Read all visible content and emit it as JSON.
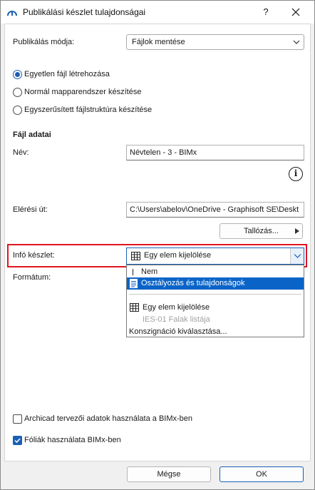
{
  "window": {
    "title": "Publikálási készlet tulajdonságai",
    "help_label": "?"
  },
  "publish_mode": {
    "label": "Publikálás módja:",
    "value": "Fájlok mentése"
  },
  "radio_options": [
    {
      "label": "Egyetlen fájl létrehozása",
      "selected": true
    },
    {
      "label": "Normál mapparendszer készítése",
      "selected": false
    },
    {
      "label": "Egyszerűsített fájlstruktúra készítése",
      "selected": false
    }
  ],
  "file_data": {
    "heading": "Fájl adatai",
    "name_label": "Név:",
    "name_value": "Névtelen - 3 - BIMx",
    "info_icon": "i",
    "path_label": "Elérési út:",
    "path_value": "C:\\Users\\abelov\\OneDrive - Graphisoft SE\\Deskt",
    "browse_label": "Tallózás..."
  },
  "info_set": {
    "label": "Infó készlet:",
    "selected": "Egy elem kijelölése",
    "options": [
      {
        "label": "Nem",
        "icon": "text-cursor-icon",
        "disabled": false,
        "highlighted": false
      },
      {
        "label": "Osztályozás és tulajdonságok",
        "icon": "document-icon",
        "disabled": false,
        "highlighted": true
      },
      {
        "label": "Egy elem kijelölése",
        "icon": "grid-icon",
        "disabled": false,
        "highlighted": false
      },
      {
        "label": "IES-01 Falak listája",
        "icon": "",
        "disabled": true,
        "highlighted": false
      },
      {
        "label": "Konszignáció kiválasztása...",
        "icon": "",
        "disabled": false,
        "highlighted": false
      }
    ]
  },
  "format_label": "Formátum:",
  "checkboxes": [
    {
      "label": "Archicad tervezői adatok használata a BIMx-ben",
      "checked": false
    },
    {
      "label": "Fóliák használata BIMx-ben",
      "checked": true
    }
  ],
  "buttons": {
    "cancel": "Mégse",
    "ok": "OK"
  },
  "colors": {
    "accent": "#1a5fb4",
    "highlight_border": "#e0141e",
    "selection": "#0a64c8"
  }
}
